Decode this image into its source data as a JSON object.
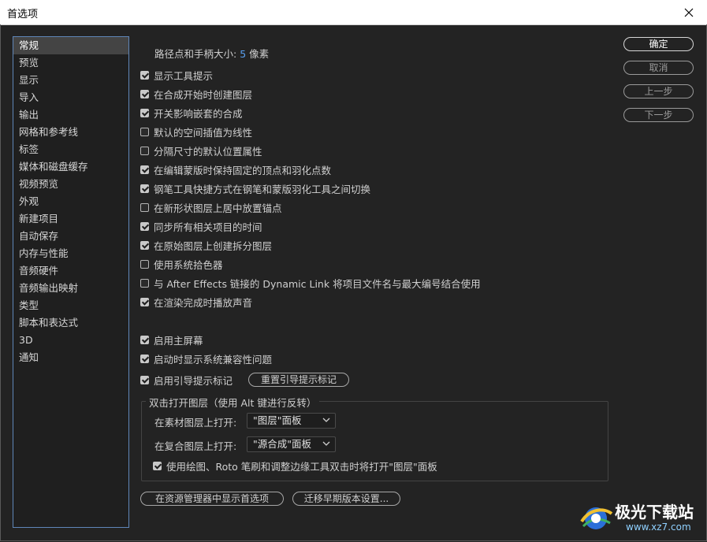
{
  "window": {
    "title": "首选项"
  },
  "sidebar": {
    "items": [
      {
        "label": "常规",
        "selected": true
      },
      {
        "label": "预览"
      },
      {
        "label": "显示"
      },
      {
        "label": "导入"
      },
      {
        "label": "输出"
      },
      {
        "label": "网格和参考线"
      },
      {
        "label": "标签"
      },
      {
        "label": "媒体和磁盘缓存"
      },
      {
        "label": "视频预览"
      },
      {
        "label": "外观"
      },
      {
        "label": "新建项目"
      },
      {
        "label": "自动保存"
      },
      {
        "label": "内存与性能"
      },
      {
        "label": "音频硬件"
      },
      {
        "label": "音频输出映射"
      },
      {
        "label": "类型"
      },
      {
        "label": "脚本和表达式"
      },
      {
        "label": "3D"
      },
      {
        "label": "通知"
      }
    ]
  },
  "buttons": {
    "ok": "确定",
    "cancel": "取消",
    "prev": "上一步",
    "next": "下一步"
  },
  "path": {
    "label": "路径点和手柄大小:",
    "value": "5",
    "unit": "像素"
  },
  "options": [
    {
      "label": "显示工具提示",
      "checked": true
    },
    {
      "label": "在合成开始时创建图层",
      "checked": true
    },
    {
      "label": "开关影响嵌套的合成",
      "checked": true
    },
    {
      "label": "默认的空间插值为线性",
      "checked": false
    },
    {
      "label": "分隔尺寸的默认位置属性",
      "checked": false
    },
    {
      "label": "在编辑蒙版时保持固定的顶点和羽化点数",
      "checked": true
    },
    {
      "label": "钢笔工具快捷方式在钢笔和蒙版羽化工具之间切换",
      "checked": true
    },
    {
      "label": "在新形状图层上居中放置锚点",
      "checked": false
    },
    {
      "label": "同步所有相关项目的时间",
      "checked": true
    },
    {
      "label": "在原始图层上创建拆分图层",
      "checked": true
    },
    {
      "label": "使用系统拾色器",
      "checked": false
    },
    {
      "label": "与 After Effects 链接的 Dynamic Link 将项目文件名与最大编号结合使用",
      "checked": false
    },
    {
      "label": "在渲染完成时播放声音",
      "checked": true
    }
  ],
  "options2": [
    {
      "label": "启用主屏幕",
      "checked": true
    },
    {
      "label": "启动时显示系统兼容性问题",
      "checked": true
    },
    {
      "label": "启用引导提示标记",
      "checked": true
    }
  ],
  "reset_hints_button": "重置引导提示标记",
  "double_click_group": {
    "title": "双击打开图层（使用 Alt 键进行反转）",
    "footage_label": "在素材图层上打开:",
    "footage_value": "\"图层\"面板",
    "comp_label": "在复合图层上打开:",
    "comp_value": "\"源合成\"面板",
    "paint_option": {
      "label": "使用绘图、Roto 笔刷和调整边缘工具双击时将打开\"图层\"面板",
      "checked": true
    }
  },
  "bottom_buttons": {
    "reveal": "在资源管理器中显示首选项",
    "migrate": "迁移早期版本设置..."
  },
  "watermark": {
    "name": "极光下载站",
    "url": "www.xz7.com"
  },
  "colors": {
    "accent": "#5aa0f0",
    "sidebar_border": "#5f86b8",
    "background": "#232323"
  }
}
